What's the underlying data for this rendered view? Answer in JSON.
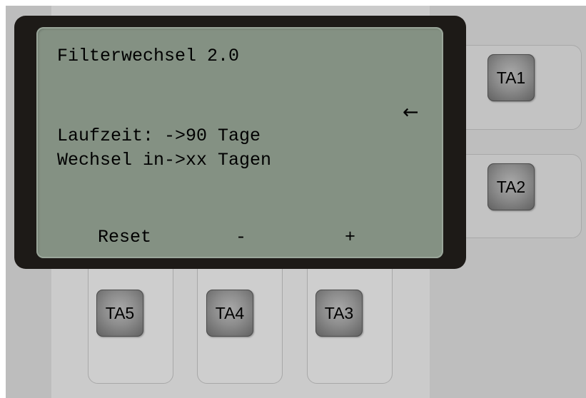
{
  "display": {
    "title": "Filterwechsel 2.0",
    "arrow": "←",
    "line_runtime": "Laufzeit: ->90 Tage",
    "line_change": "Wechsel in->xx Tagen",
    "softkeys": {
      "reset": "Reset",
      "minus": "-",
      "plus": "+"
    }
  },
  "keys": {
    "ta1": "TA1",
    "ta2": "TA2",
    "ta3": "TA3",
    "ta4": "TA4",
    "ta5": "TA5"
  },
  "colors": {
    "lcd_background": "#849183",
    "bezel": "#1d1a17",
    "key_face": "#8c8c8c"
  }
}
